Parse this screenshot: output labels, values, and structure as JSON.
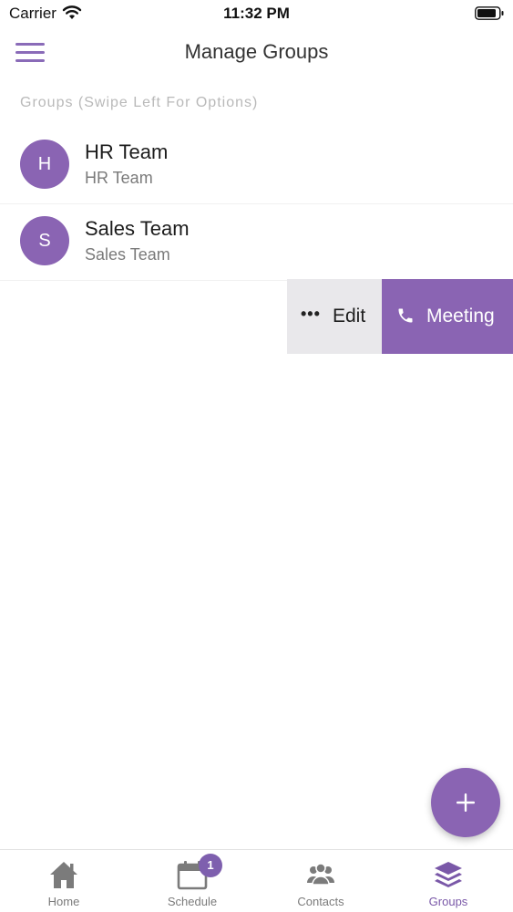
{
  "status_bar": {
    "carrier": "Carrier",
    "time": "11:32 PM",
    "wifi_icon": "wifi-icon",
    "battery_icon": "battery-icon"
  },
  "header": {
    "title": "Manage Groups",
    "menu_icon": "hamburger-menu-icon"
  },
  "section_label": "Groups (Swipe Left For Options)",
  "groups": [
    {
      "initial": "H",
      "name": "HR Team",
      "subtitle": "HR Team"
    },
    {
      "initial": "S",
      "name": "Sales Team",
      "subtitle": "Sales Team"
    }
  ],
  "swipe_actions": {
    "edit_icon": "more-dots-icon",
    "edit_label": "Edit",
    "meeting_icon": "phone-icon",
    "meeting_label": "Meeting"
  },
  "fab": {
    "icon": "plus-icon"
  },
  "tabs": [
    {
      "label": "Home",
      "icon": "home-icon",
      "active": false
    },
    {
      "label": "Schedule",
      "icon": "calendar-icon",
      "active": false,
      "badge": "1"
    },
    {
      "label": "Contacts",
      "icon": "contacts-icon",
      "active": false
    },
    {
      "label": "Groups",
      "icon": "layers-icon",
      "active": true
    }
  ],
  "colors": {
    "accent": "#8a64b3",
    "edit_bg": "#e9e8eb",
    "inactive_tab": "#7b7b7b",
    "active_tab": "#7a58a8"
  }
}
